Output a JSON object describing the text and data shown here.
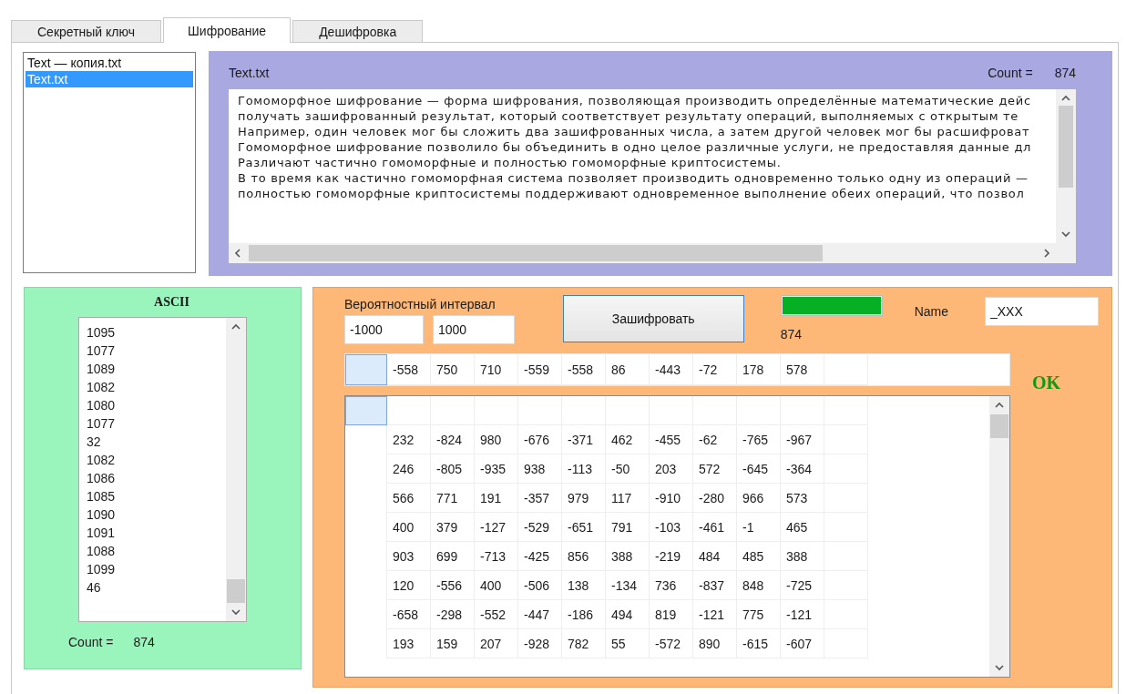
{
  "tabs": [
    {
      "label": "Секретный ключ",
      "selected": false
    },
    {
      "label": "Шифрование",
      "selected": true
    },
    {
      "label": "Дешифровка",
      "selected": false
    }
  ],
  "files": [
    {
      "name": "Text — копия.txt",
      "selected": false
    },
    {
      "name": "Text.txt",
      "selected": true
    }
  ],
  "text_panel": {
    "file_name": "Text.txt",
    "count_label": "Count =",
    "count_value": "874",
    "lines": [
      "Гомоморфное шифрование — форма шифрования, позволяющая производить определённые математические дейс",
      "получать зашифрованный результат, который соответствует результату операций, выполняемых с открытым те",
      "Например, один человек мог бы сложить два зашифрованных числа, а затем другой человек мог бы расшифроват",
      "Гомоморфное шифрование позволило бы объединить в одно целое различные услуги, не предоставляя данные дл",
      "Различают частично гомоморфные и полностью гомоморфные криптосистемы.",
      "В то время как частично гомоморфная система позволяет производить одновременно только одну из операций —",
      "полностью гомоморфные криптосистемы поддерживают одновременное выполнение обеих операций, что позвол"
    ]
  },
  "ascii_panel": {
    "title": "ASCII",
    "codes": [
      "1095",
      "1077",
      "1089",
      "1082",
      "1080",
      "1077",
      "32",
      "1082",
      "1086",
      "1085",
      "1090",
      "1091",
      "1088",
      "1099",
      "46"
    ],
    "count_label": "Count =",
    "count_value": "874"
  },
  "encrypt_panel": {
    "interval_label": "Вероятностный интервал",
    "interval_min": "-1000",
    "interval_max": "1000",
    "encrypt_button": "Зашифровать",
    "progress": {
      "level": 1
    },
    "progress_count": "874",
    "name_label": "Name",
    "name_value": "_XXX",
    "status": "OK",
    "key_row": [
      "-558",
      "750",
      "710",
      "-559",
      "-558",
      "86",
      "-443",
      "-72",
      "178",
      "578"
    ],
    "rows": [
      [
        "232",
        "-824",
        "980",
        "-676",
        "-371",
        "462",
        "-455",
        "-62",
        "-765",
        "-967"
      ],
      [
        "246",
        "-805",
        "-935",
        "938",
        "-113",
        "-50",
        "203",
        "572",
        "-645",
        "-364"
      ],
      [
        "566",
        "771",
        "191",
        "-357",
        "979",
        "117",
        "-910",
        "-280",
        "966",
        "573"
      ],
      [
        "400",
        "379",
        "-127",
        "-529",
        "-651",
        "791",
        "-103",
        "-461",
        "-1",
        "465"
      ],
      [
        "903",
        "699",
        "-713",
        "-425",
        "856",
        "388",
        "-219",
        "484",
        "485",
        "388"
      ],
      [
        "120",
        "-556",
        "400",
        "-506",
        "138",
        "-134",
        "736",
        "-837",
        "848",
        "-725"
      ],
      [
        "-658",
        "-298",
        "-552",
        "-447",
        "-186",
        "494",
        "819",
        "-121",
        "775",
        "-121"
      ],
      [
        "193",
        "159",
        "207",
        "-928",
        "782",
        "55",
        "-572",
        "890",
        "-615",
        "-607"
      ]
    ]
  }
}
